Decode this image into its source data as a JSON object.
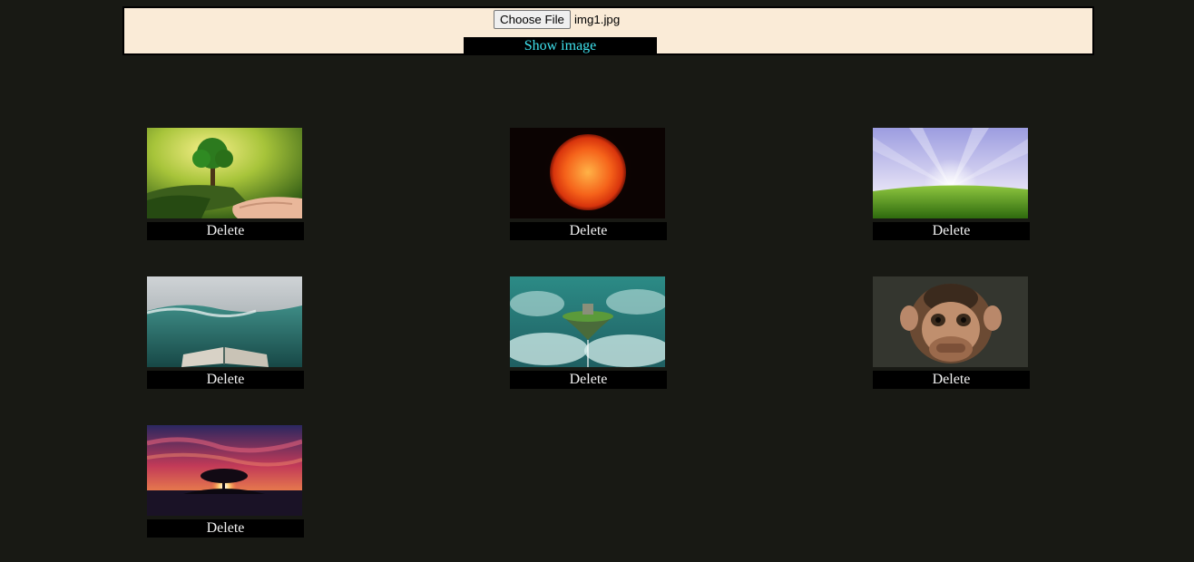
{
  "upload": {
    "choose_file_label": "Choose File",
    "file_name": "img1.jpg",
    "show_image_label": "Show image"
  },
  "gallery": {
    "items": [
      {
        "image": "tree-in-hand",
        "delete_label": "Delete"
      },
      {
        "image": "sun",
        "delete_label": "Delete"
      },
      {
        "image": "sky-over-meadow",
        "delete_label": "Delete"
      },
      {
        "image": "open-book-in-sea",
        "delete_label": "Delete"
      },
      {
        "image": "floating-island",
        "delete_label": "Delete"
      },
      {
        "image": "monkey",
        "delete_label": "Delete"
      },
      {
        "image": "tree-at-sunset",
        "delete_label": "Delete"
      }
    ]
  },
  "colors": {
    "page_background": "#181914",
    "panel_background": "#faebd7",
    "show_image_text": "#3fe2ee",
    "button_background": "#000000"
  }
}
